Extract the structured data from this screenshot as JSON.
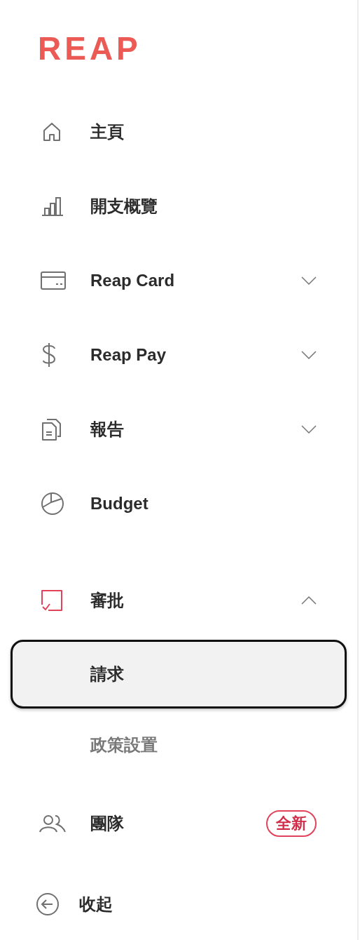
{
  "logo": "REAP",
  "nav": [
    {
      "label": "主頁"
    },
    {
      "label": "開支概覽"
    },
    {
      "label": "Reap Card",
      "expanded": false
    },
    {
      "label": "Reap Pay",
      "expanded": false
    },
    {
      "label": "報告",
      "expanded": false
    },
    {
      "label": "Budget"
    }
  ],
  "approval": {
    "label": "審批",
    "expanded": true,
    "active": true,
    "children": [
      {
        "label": "請求",
        "selected": true
      },
      {
        "label": "政策設置",
        "selected": false
      }
    ]
  },
  "team": {
    "label": "團隊",
    "badge": "全新"
  },
  "collapse": {
    "label": "收起"
  }
}
